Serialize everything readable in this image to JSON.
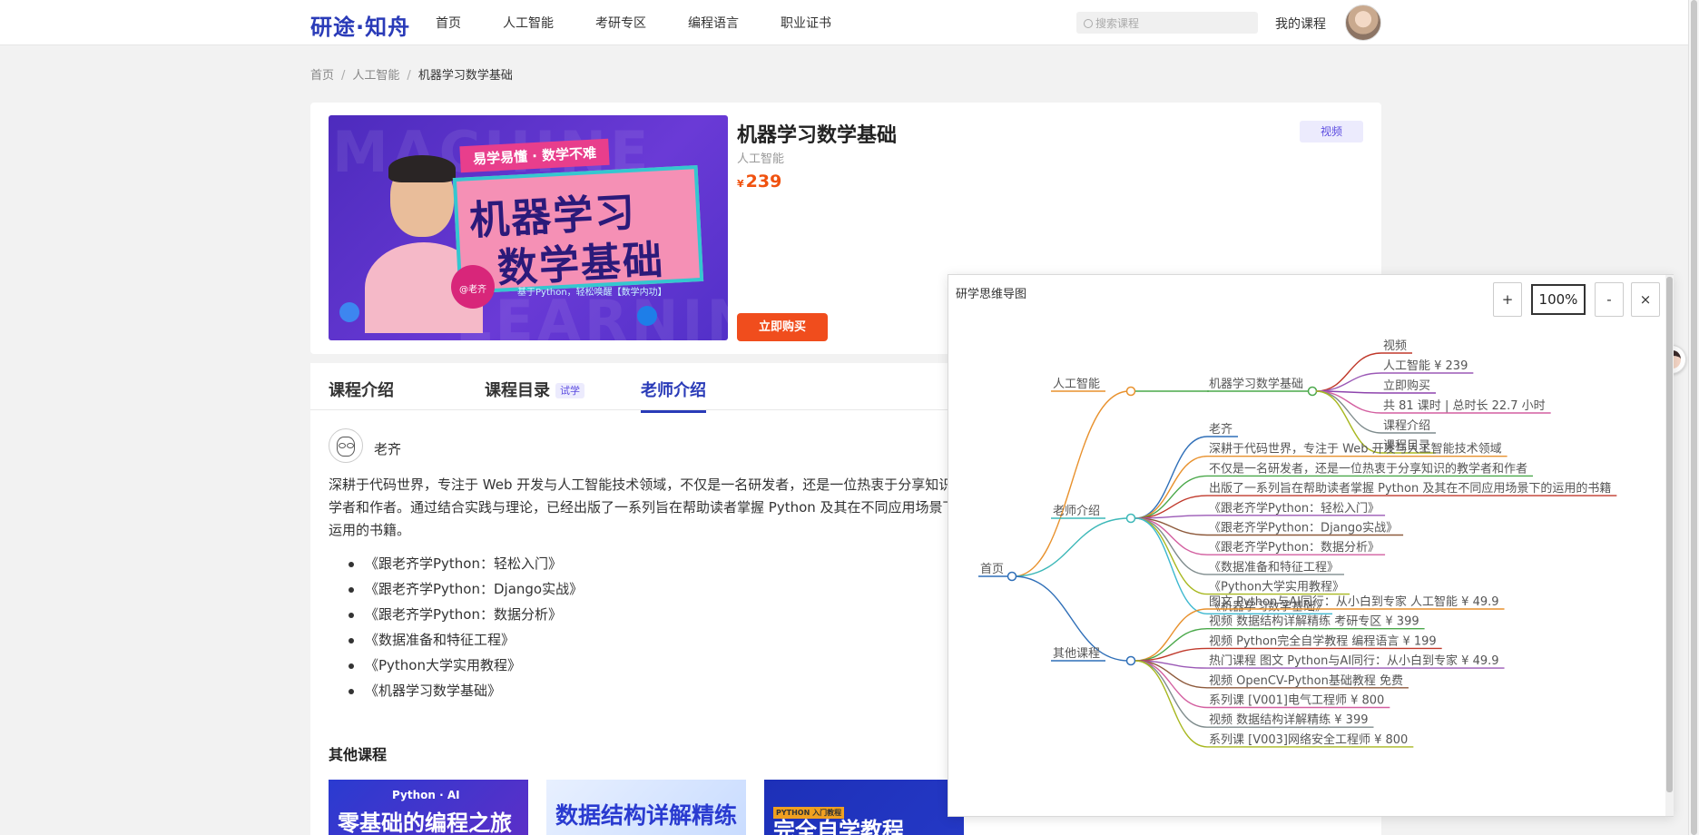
{
  "header": {
    "logo": "研途·知舟",
    "nav": [
      "首页",
      "人工智能",
      "考研专区",
      "编程语言",
      "职业证书"
    ],
    "search_placeholder": "搜索课程",
    "my_courses": "我的课程"
  },
  "breadcrumb": [
    "首页",
    "人工智能",
    "机器学习数学基础"
  ],
  "course": {
    "title": "机器学习数学基础",
    "category": "人工智能",
    "currency": "¥",
    "price": "239",
    "tag": "视频",
    "buy_label": "立即购买",
    "cover": {
      "top_banner": "易学易懂 · 数学不难",
      "line1": "机器学习",
      "line2": "数学基础",
      "subtitle": "基于Python，轻松唤醒【数学内功】",
      "badge": "@老齐",
      "bg_word1": "MACHINE",
      "bg_word2": "LEARNING"
    }
  },
  "tabs": {
    "intro": "课程介绍",
    "catalog": "课程目录",
    "trial": "试学",
    "teacher": "老师介绍"
  },
  "teacher": {
    "name": "老齐",
    "bio": "深耕于代码世界，专注于 Web 开发与人工智能技术领域，不仅是一名研发者，还是一位热衷于分享知识的教学者和作者。通过结合实践与理论，已经出版了一系列旨在帮助读者掌握 Python 及其在不同应用场景下的运用的书籍。",
    "books": [
      "《跟老齐学Python：轻松入门》",
      "《跟老齐学Python：Django实战》",
      "《跟老齐学Python：数据分析》",
      "《数据准备和特征工程》",
      "《Python大学实用教程》",
      "《机器学习数学基础》"
    ]
  },
  "other_courses": {
    "title": "其他课程",
    "cards": [
      {
        "top": "Python · AI",
        "text": "零基础的编程之旅"
      },
      {
        "top": "",
        "text": "数据结构详解精练"
      },
      {
        "top": "PYTHON 入门教程",
        "text": "完全自学教程"
      }
    ]
  },
  "mindmap": {
    "title": "研学思维导图",
    "zoom_in": "+",
    "zoom_value": "100%",
    "zoom_out": "-",
    "close": "×",
    "root": "首页",
    "branches": [
      {
        "label": "人工智能",
        "color": "#e8912d",
        "children": [
          {
            "label": "机器学习数学基础",
            "color": "#4aa84a",
            "leaves": [
              {
                "text": "视频",
                "color": "#c0392b"
              },
              {
                "text": "人工智能 ¥ 239",
                "color": "#9b59b6"
              },
              {
                "text": "立即购买",
                "color": "#8e44ad"
              },
              {
                "text": "共 81 课时 | 总时长 22.7 小时",
                "color": "#d35fa0"
              },
              {
                "text": "课程介绍",
                "color": "#7f8c8d"
              },
              {
                "text": "课程目录",
                "color": "#a8b820"
              }
            ]
          }
        ]
      },
      {
        "label": "老师介绍",
        "color": "#3db8b8",
        "leaves": [
          {
            "text": "老齐",
            "color": "#2f6fb8"
          },
          {
            "text": "深耕于代码世界，专注于 Web 开发与人工智能技术领域",
            "color": "#e8912d"
          },
          {
            "text": "不仅是一名研发者，还是一位热衷于分享知识的教学者和作者",
            "color": "#4aa84a"
          },
          {
            "text": "出版了一系列旨在帮助读者掌握 Python 及其在不同应用场景下的运用的书籍",
            "color": "#c0392b"
          },
          {
            "text": "《跟老齐学Python：轻松入门》",
            "color": "#9b59b6"
          },
          {
            "text": "《跟老齐学Python：Django实战》",
            "color": "#8e5a3c"
          },
          {
            "text": "《跟老齐学Python：数据分析》",
            "color": "#d35fa0"
          },
          {
            "text": "《数据准备和特征工程》",
            "color": "#7f8c8d"
          },
          {
            "text": "《Python大学实用教程》",
            "color": "#a8b820"
          },
          {
            "text": "《机器学习数学基础》",
            "color": "#3db8d0"
          }
        ]
      },
      {
        "label": "其他课程",
        "color": "#2f6fb8",
        "leaves": [
          {
            "text": "图文 Python与AI同行：从小白到专家 人工智能 ¥ 49.9",
            "color": "#e8912d"
          },
          {
            "text": "视频 数据结构详解精练 考研专区 ¥ 399",
            "color": "#4aa84a"
          },
          {
            "text": "视频 Python完全自学教程 编程语言 ¥ 199",
            "color": "#c0392b"
          },
          {
            "text": "热门课程 图文 Python与AI同行：从小白到专家 ¥ 49.9",
            "color": "#9b59b6"
          },
          {
            "text": "视频 OpenCV-Python基础教程 免费",
            "color": "#8e5a3c"
          },
          {
            "text": "系列课 [V001]电气工程师 ¥ 800",
            "color": "#d35fa0"
          },
          {
            "text": "视频 数据结构详解精练 ¥ 399",
            "color": "#7f8c8d"
          },
          {
            "text": "系列课 [V003]网络安全工程师 ¥ 800",
            "color": "#a8b820"
          }
        ]
      }
    ]
  }
}
